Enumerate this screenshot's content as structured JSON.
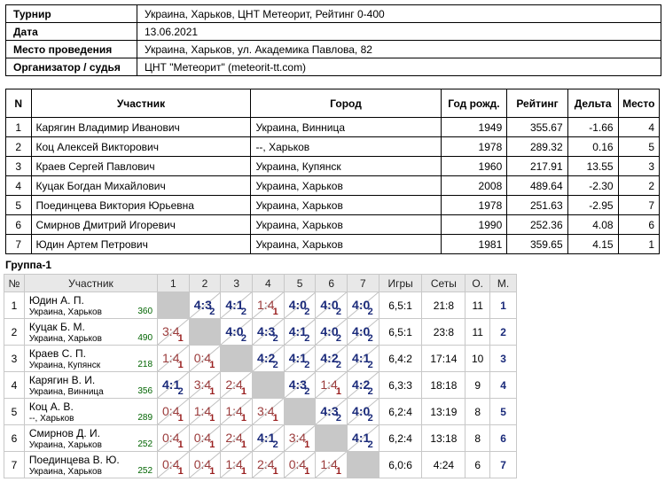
{
  "info": [
    {
      "k": "Турнир",
      "v": "Украина, Харьков, ЦНТ Метеорит, Рейтинг 0-400"
    },
    {
      "k": "Дата",
      "v": "13.06.2021"
    },
    {
      "k": "Место проведения",
      "v": "Украина, Харьков, ул. Академика Павлова, 82"
    },
    {
      "k": "Организатор / судья",
      "v": "ЦНТ \"Метеорит\" (meteorit-tt.com)"
    }
  ],
  "table": {
    "headers": [
      "N",
      "Участник",
      "Город",
      "Год рожд.",
      "Рейтинг",
      "Дельта",
      "Место"
    ],
    "rows": [
      [
        "1",
        "Карягин Владимир Иванович",
        "Украина, Винница",
        "1949",
        "355.67",
        "-1.66",
        "4"
      ],
      [
        "2",
        "Коц Алексей Викторович",
        "--, Харьков",
        "1978",
        "289.32",
        "0.16",
        "5"
      ],
      [
        "3",
        "Краев Сергей Павлович",
        "Украина, Купянск",
        "1960",
        "217.91",
        "13.55",
        "3"
      ],
      [
        "4",
        "Куцак Богдан Михайлович",
        "Украина, Харьков",
        "2008",
        "489.64",
        "-2.30",
        "2"
      ],
      [
        "5",
        "Поединцева Виктория Юрьевна",
        "Украина, Харьков",
        "1978",
        "251.63",
        "-2.95",
        "7"
      ],
      [
        "6",
        "Смирнов Дмитрий Игоревич",
        "Украина, Харьков",
        "1990",
        "252.36",
        "4.08",
        "6"
      ],
      [
        "7",
        "Юдин Артем Петрович",
        "Украина, Харьков",
        "1981",
        "359.65",
        "4.15",
        "1"
      ]
    ]
  },
  "group": {
    "title": "Группа-1",
    "headers": [
      "№",
      "Участник",
      "1",
      "2",
      "3",
      "4",
      "5",
      "6",
      "7",
      "Игры",
      "Сеты",
      "О.",
      "М."
    ],
    "rows": [
      {
        "n": "1",
        "name": "Юдин А. П.",
        "city": "Украина, Харьков",
        "rating": "360",
        "cells": [
          null,
          [
            "4:3",
            "2"
          ],
          [
            "4:1",
            "2"
          ],
          [
            "1:4",
            "1"
          ],
          [
            "4:0",
            "2"
          ],
          [
            "4:0",
            "2"
          ],
          [
            "4:0",
            "2"
          ]
        ],
        "games": "6,5:1",
        "sets": "21:8",
        "o": "11",
        "m": "1"
      },
      {
        "n": "2",
        "name": "Куцак Б. М.",
        "city": "Украина, Харьков",
        "rating": "490",
        "cells": [
          [
            "3:4",
            "1"
          ],
          null,
          [
            "4:0",
            "2"
          ],
          [
            "4:3",
            "2"
          ],
          [
            "4:1",
            "2"
          ],
          [
            "4:0",
            "2"
          ],
          [
            "4:0",
            "2"
          ]
        ],
        "games": "6,5:1",
        "sets": "23:8",
        "o": "11",
        "m": "2"
      },
      {
        "n": "3",
        "name": "Краев С. П.",
        "city": "Украина, Купянск",
        "rating": "218",
        "cells": [
          [
            "1:4",
            "1"
          ],
          [
            "0:4",
            "1"
          ],
          null,
          [
            "4:2",
            "2"
          ],
          [
            "4:1",
            "2"
          ],
          [
            "4:2",
            "2"
          ],
          [
            "4:1",
            "2"
          ]
        ],
        "games": "6,4:2",
        "sets": "17:14",
        "o": "10",
        "m": "3"
      },
      {
        "n": "4",
        "name": "Карягин В. И.",
        "city": "Украина, Винница",
        "rating": "356",
        "cells": [
          [
            "4:1",
            "2"
          ],
          [
            "3:4",
            "1"
          ],
          [
            "2:4",
            "1"
          ],
          null,
          [
            "4:3",
            "2"
          ],
          [
            "1:4",
            "1"
          ],
          [
            "4:2",
            "2"
          ]
        ],
        "games": "6,3:3",
        "sets": "18:18",
        "o": "9",
        "m": "4"
      },
      {
        "n": "5",
        "name": "Коц А. В.",
        "city": "--, Харьков",
        "rating": "289",
        "cells": [
          [
            "0:4",
            "1"
          ],
          [
            "1:4",
            "1"
          ],
          [
            "1:4",
            "1"
          ],
          [
            "3:4",
            "1"
          ],
          null,
          [
            "4:3",
            "2"
          ],
          [
            "4:0",
            "2"
          ]
        ],
        "games": "6,2:4",
        "sets": "13:19",
        "o": "8",
        "m": "5"
      },
      {
        "n": "6",
        "name": "Смирнов Д. И.",
        "city": "Украина, Харьков",
        "rating": "252",
        "cells": [
          [
            "0:4",
            "1"
          ],
          [
            "0:4",
            "1"
          ],
          [
            "2:4",
            "1"
          ],
          [
            "4:1",
            "2"
          ],
          [
            "3:4",
            "1"
          ],
          null,
          [
            "4:1",
            "2"
          ]
        ],
        "games": "6,2:4",
        "sets": "13:18",
        "o": "8",
        "m": "6"
      },
      {
        "n": "7",
        "name": "Поединцева В. Ю.",
        "city": "Украина, Харьков",
        "rating": "252",
        "cells": [
          [
            "0:4",
            "1"
          ],
          [
            "0:4",
            "1"
          ],
          [
            "1:4",
            "1"
          ],
          [
            "2:4",
            "1"
          ],
          [
            "0:4",
            "1"
          ],
          [
            "1:4",
            "1"
          ],
          null
        ],
        "games": "6,0:6",
        "sets": "4:24",
        "o": "6",
        "m": "7"
      }
    ]
  }
}
